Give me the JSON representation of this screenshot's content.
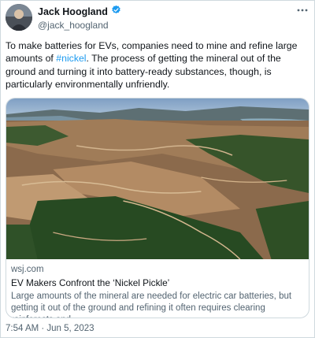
{
  "author": {
    "name": "Jack Hoogland",
    "handle": "@jack_hoogland",
    "verified": true
  },
  "tweet": {
    "text_before": "To make batteries for EVs, companies need to mine and refine large amounts of ",
    "hashtag": "#nickel",
    "text_after": ". The process of getting the mineral out of the ground and turning it into battery-ready substances, though, is particularly environmentally unfriendly."
  },
  "card": {
    "domain": "wsj.com",
    "title": "EV Makers Confront the ‘Nickel Pickle’",
    "description": "Large amounts of the mineral are needed for electric car batteries, but getting it out of the ground and refining it often requires clearing rainforests and ..."
  },
  "timestamp": "7:54 AM · Jun 5, 2023",
  "icons": {
    "verified": "verified-badge-icon",
    "menu": "more-options-icon"
  },
  "colors": {
    "link": "#1d9bf0",
    "secondary_text": "#536471",
    "border": "#cfd9de"
  }
}
